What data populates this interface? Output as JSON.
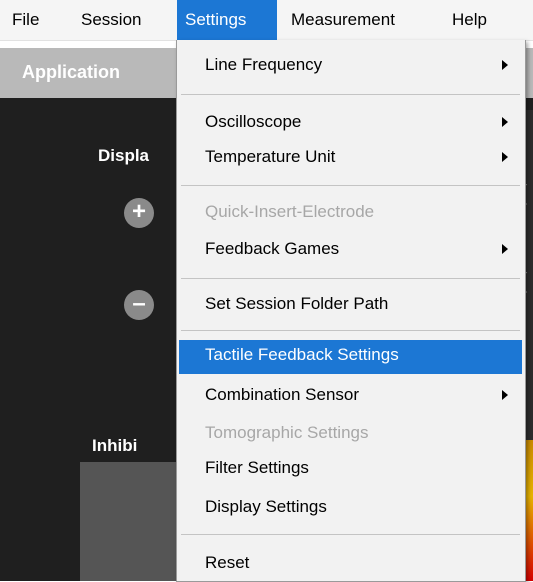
{
  "menubar": {
    "items": [
      {
        "label": "File",
        "active": false
      },
      {
        "label": "Session",
        "active": false
      },
      {
        "label": "Settings",
        "active": true
      },
      {
        "label": "Measurement",
        "active": false
      },
      {
        "label": "Help",
        "active": false
      }
    ]
  },
  "background": {
    "header_label": "Application",
    "display_label": "Displa",
    "inhibit_label": "Inhibi",
    "plus_symbol": "+",
    "minus_symbol": "–"
  },
  "settings_menu": {
    "items": [
      {
        "label": "Line Frequency",
        "submenu": true,
        "enabled": true
      },
      {
        "label": "Oscilloscope",
        "submenu": true,
        "enabled": true
      },
      {
        "label": "Temperature Unit",
        "submenu": true,
        "enabled": true
      },
      {
        "label": "Quick-Insert-Electrode",
        "submenu": false,
        "enabled": false
      },
      {
        "label": "Feedback Games",
        "submenu": true,
        "enabled": true
      },
      {
        "label": "Set Session Folder Path",
        "submenu": false,
        "enabled": true
      },
      {
        "label": "Tactile Feedback Settings",
        "submenu": false,
        "enabled": true,
        "highlighted": true
      },
      {
        "label": "Combination Sensor",
        "submenu": true,
        "enabled": true
      },
      {
        "label": "Tomographic Settings",
        "submenu": false,
        "enabled": false
      },
      {
        "label": "Filter Settings",
        "submenu": false,
        "enabled": true
      },
      {
        "label": "Display Settings",
        "submenu": false,
        "enabled": true
      },
      {
        "label": "Reset",
        "submenu": false,
        "enabled": true
      }
    ]
  },
  "colors": {
    "highlight": "#1c77d4",
    "disabled_text": "#a7a7a7",
    "menu_bg": "#f2f2f2"
  }
}
